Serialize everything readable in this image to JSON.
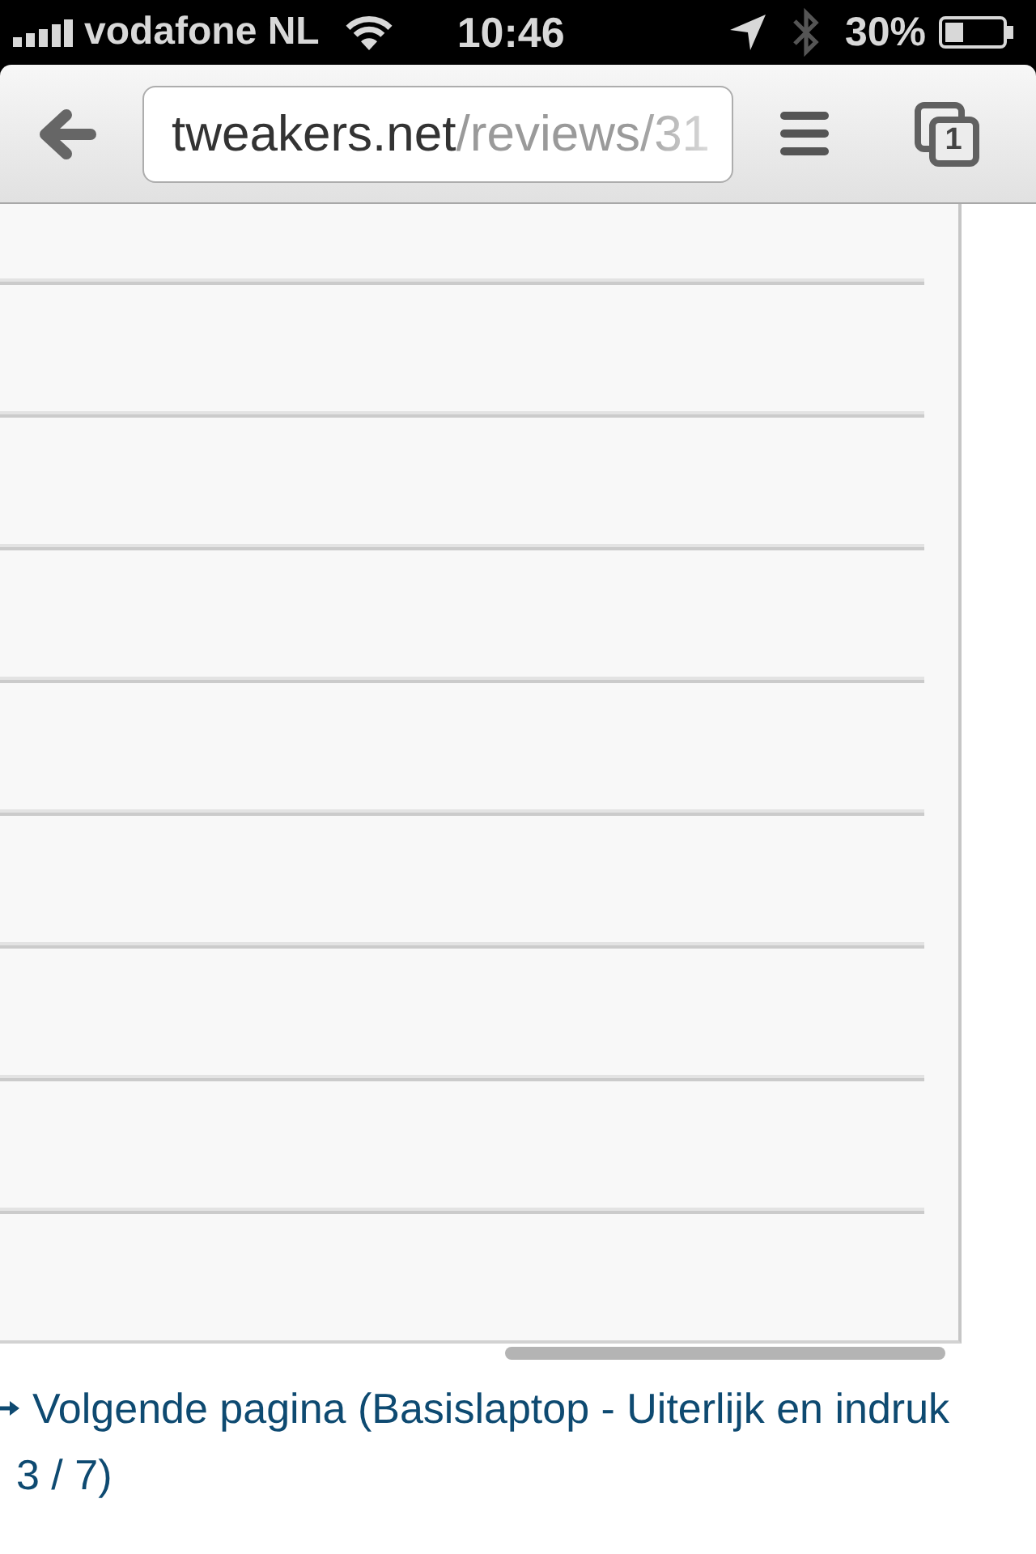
{
  "status_bar": {
    "carrier": "vodafone NL",
    "time": "10:46",
    "bluetooth_connected": false,
    "battery": "30%"
  },
  "toolbar": {
    "url": {
      "host": "tweakers.net",
      "path": "/reviews/31"
    },
    "tab_count": "1"
  },
  "content": {
    "next_link": {
      "lines": [
        "Volgende pagina (Basislaptop - Uiterlijk en indruk",
        "3 / 7)"
      ]
    }
  }
}
